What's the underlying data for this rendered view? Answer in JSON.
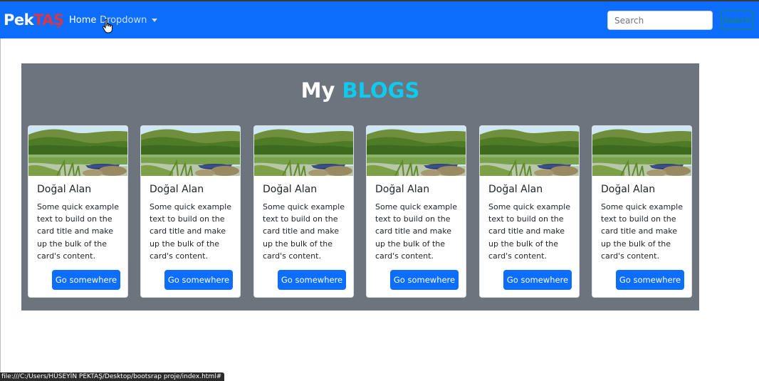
{
  "navbar": {
    "brand_part1": "Pek",
    "brand_part2": "TAŞ",
    "home_label": "Home",
    "dropdown_label": "Dropdown",
    "search_placeholder": "Search",
    "search_button_label": "Search",
    "background_color": "#0d6efd"
  },
  "blogs": {
    "heading_part1": "My",
    "heading_part2": "BLOGS",
    "background_color": "#6c757d",
    "accent_color": "#0dcaf0",
    "cards": [
      {
        "title": "Doğal Alan",
        "text": "Some quick example text to build on the card title and make up the bulk of the card's content.",
        "button": "Go somewhere",
        "image_icon": "lake-landscape-image"
      },
      {
        "title": "Doğal Alan",
        "text": "Some quick example text to build on the card title and make up the bulk of the card's content.",
        "button": "Go somewhere",
        "image_icon": "lake-landscape-image"
      },
      {
        "title": "Doğal Alan",
        "text": "Some quick example text to build on the card title and make up the bulk of the card's content.",
        "button": "Go somewhere",
        "image_icon": "lake-landscape-image"
      },
      {
        "title": "Doğal Alan",
        "text": "Some quick example text to build on the card title and make up the bulk of the card's content.",
        "button": "Go somewhere",
        "image_icon": "lake-landscape-image"
      },
      {
        "title": "Doğal Alan",
        "text": "Some quick example text to build on the card title and make up the bulk of the card's content.",
        "button": "Go somewhere",
        "image_icon": "lake-landscape-image"
      },
      {
        "title": "Doğal Alan",
        "text": "Some quick example text to build on the card title and make up the bulk of the card's content.",
        "button": "Go somewhere",
        "image_icon": "lake-landscape-image"
      }
    ]
  },
  "status_bar": {
    "url": "file:///C:/Users/HÜSEYİN PEKTAŞ/Desktop/bootsrap proje/index.html#"
  }
}
